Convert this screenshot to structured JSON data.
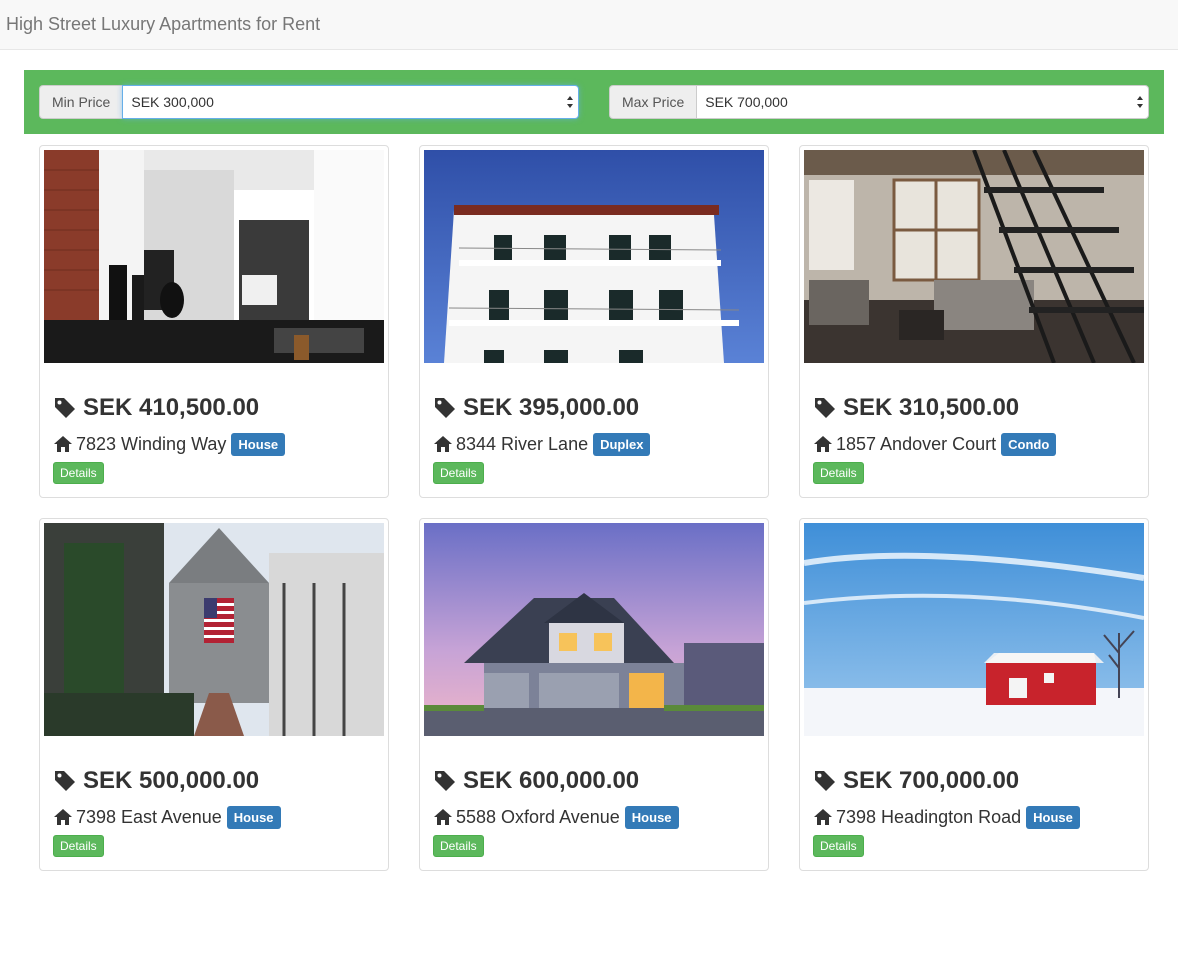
{
  "navbar": {
    "brand": "High Street Luxury Apartments for Rent"
  },
  "filters": {
    "min": {
      "label": "Min Price",
      "value": "SEK 300,000"
    },
    "max": {
      "label": "Max Price",
      "value": "SEK 700,000"
    }
  },
  "listings": [
    {
      "price": "SEK 410,500.00",
      "address": "7823 Winding Way",
      "type": "House",
      "details": "Details",
      "photo": "modern-interior-photo"
    },
    {
      "price": "SEK 395,000.00",
      "address": "8344 River Lane",
      "type": "Duplex",
      "details": "Details",
      "photo": "white-apartment-building-photo"
    },
    {
      "price": "SEK 310,500.00",
      "address": "1857 Andover Court",
      "type": "Condo",
      "details": "Details",
      "photo": "loft-staircase-photo"
    },
    {
      "price": "SEK 500,000.00",
      "address": "7398 East Avenue",
      "type": "House",
      "details": "Details",
      "photo": "shingle-house-flag-photo"
    },
    {
      "price": "SEK 600,000.00",
      "address": "5588 Oxford Avenue",
      "type": "House",
      "details": "Details",
      "photo": "suburban-house-dusk-photo"
    },
    {
      "price": "SEK 700,000.00",
      "address": "7398 Headington Road",
      "type": "House",
      "details": "Details",
      "photo": "red-barn-snow-photo"
    }
  ],
  "colors": {
    "success": "#5cb85c",
    "primary": "#337ab7",
    "navbar_bg": "#f8f8f8"
  }
}
